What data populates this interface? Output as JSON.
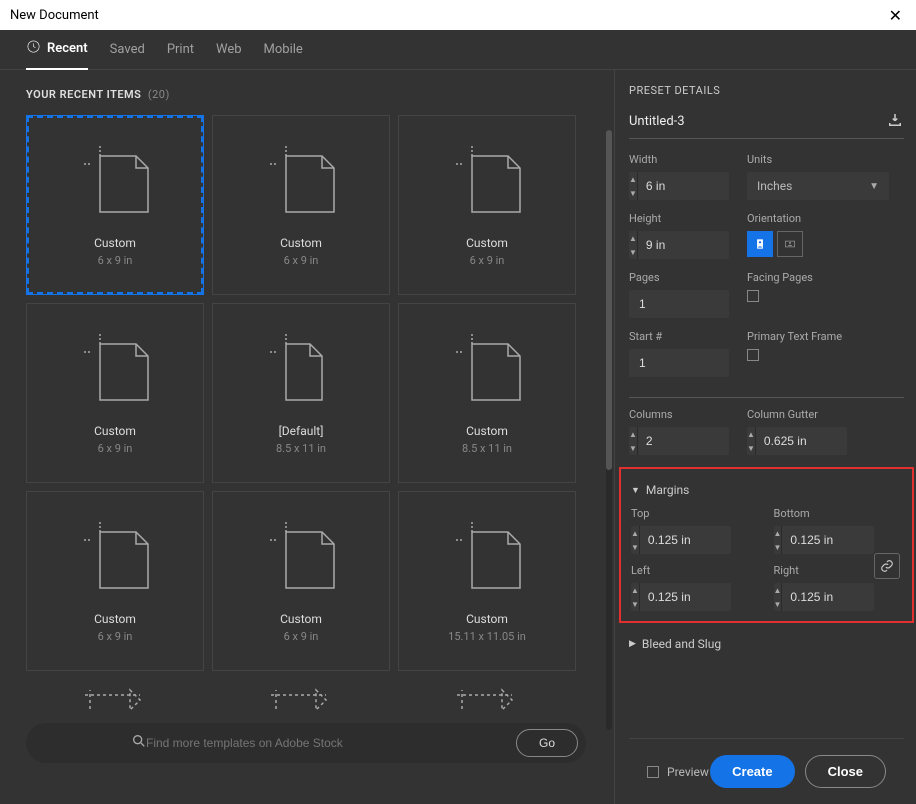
{
  "title": "New Document",
  "tabs": {
    "recent": "Recent",
    "saved": "Saved",
    "print": "Print",
    "web": "Web",
    "mobile": "Mobile"
  },
  "recent": {
    "heading": "YOUR RECENT ITEMS",
    "count": "(20)",
    "items": [
      {
        "name": "Custom",
        "size": "6 x 9 in",
        "shape": "page",
        "selected": true
      },
      {
        "name": "Custom",
        "size": "6 x 9 in",
        "shape": "page"
      },
      {
        "name": "Custom",
        "size": "6 x 9 in",
        "shape": "page"
      },
      {
        "name": "Custom",
        "size": "6 x 9 in",
        "shape": "page"
      },
      {
        "name": "[Default]",
        "size": "8.5 x 11 in",
        "shape": "page-narrow"
      },
      {
        "name": "Custom",
        "size": "8.5 x 11 in",
        "shape": "page"
      },
      {
        "name": "Custom",
        "size": "6 x 9 in",
        "shape": "page"
      },
      {
        "name": "Custom",
        "size": "6 x 9 in",
        "shape": "page"
      },
      {
        "name": "Custom",
        "size": "15.11 x 11.05 in",
        "shape": "page"
      },
      {
        "name": "",
        "size": "",
        "shape": "partial"
      },
      {
        "name": "",
        "size": "",
        "shape": "partial"
      },
      {
        "name": "",
        "size": "",
        "shape": "partial"
      }
    ]
  },
  "search": {
    "placeholder": "Find more templates on Adobe Stock",
    "go": "Go"
  },
  "preset": {
    "header": "PRESET DETAILS",
    "name": "Untitled-3",
    "width_label": "Width",
    "width": "6 in",
    "units_label": "Units",
    "units": "Inches",
    "height_label": "Height",
    "height": "9 in",
    "orientation_label": "Orientation",
    "pages_label": "Pages",
    "pages": "1",
    "facing_label": "Facing Pages",
    "facing": false,
    "start_label": "Start #",
    "start": "1",
    "primary_label": "Primary Text Frame",
    "primary": false,
    "columns_label": "Columns",
    "columns": "2",
    "gutter_label": "Column Gutter",
    "gutter": "0.625 in",
    "margins_header": "Margins",
    "top_label": "Top",
    "top": "0.125 in",
    "bottom_label": "Bottom",
    "bottom": "0.125 in",
    "left_label": "Left",
    "left": "0.125 in",
    "right_label": "Right",
    "right": "0.125 in",
    "bleed_header": "Bleed and Slug"
  },
  "footer": {
    "preview": "Preview",
    "create": "Create",
    "close": "Close"
  }
}
